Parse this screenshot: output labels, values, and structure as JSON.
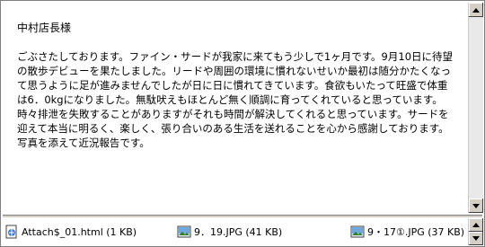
{
  "message": {
    "greeting": "中村店長様",
    "body": "ごぶさたしております。ファイン・サードが我家に来てもう少しで1ヶ月です。9月10日に待望の散歩デビューを果たしました。リードや周囲の環境に慣れないせいか最初は随分かたくなって思うように足が進みませんでしたが日に日に慣れてきています。食欲もいたって旺盛で体重は6．0kgになりました。無駄吠えもほとんど無く順調に育ってくれていると思っています。時々排泄を失敗することがありますがそれも時間が解決してくれると思っています。サードを迎えて本当に明るく、楽しく、張り合いのある生活を送れることを心から感謝しております。写真を添えて近況報告です。"
  },
  "attachments": [
    {
      "name": "Attach$_01.html (1 KB)",
      "icon": "html-file-icon"
    },
    {
      "name": "9．19.JPG (41 KB)",
      "icon": "image-file-icon"
    },
    {
      "name": "9・17①.JPG (37 KB)",
      "icon": "image-file-icon"
    }
  ],
  "colors": {
    "scrollbar": "#d4d0c8",
    "border": "#808080"
  }
}
